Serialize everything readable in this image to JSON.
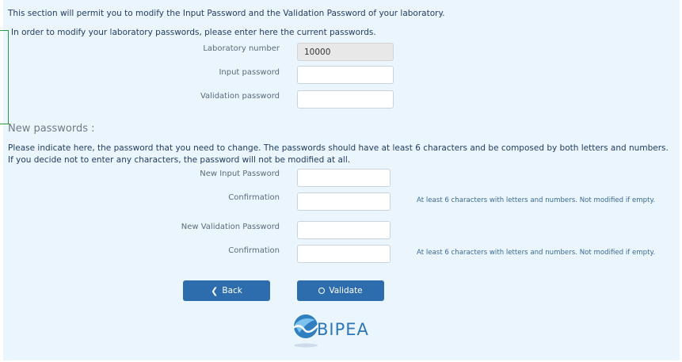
{
  "intro": "This section will permit you to modify the Input Password and the Validation Password of your laboratory.",
  "current": {
    "instruction": "In order to modify your laboratory passwords, please enter here the current passwords.",
    "lab_number_label": "Laboratory number",
    "lab_number_value": "10000",
    "input_password_label": "Input password",
    "validation_password_label": "Validation password"
  },
  "new": {
    "heading": "New passwords :",
    "instruction": "Please indicate here, the password that you need to change. The passwords should have at least 6 characters and be composed by both letters and numbers. If you decide not to enter any characters, the password will not be modified at all.",
    "new_input_label": "New Input Password",
    "confirmation_label": "Confirmation",
    "new_validation_label": "New Validation Password",
    "hint": "At least 6 characters with letters and numbers. Not modified if empty."
  },
  "buttons": {
    "back": "Back",
    "validate": "Validate"
  },
  "logo": {
    "text": "BIPEA"
  },
  "colors": {
    "panel": "#eaf5fd",
    "button": "#2e6dad",
    "bracket": "#2e9b3b",
    "text": "#1f3a5f"
  },
  "icons": {
    "back": "chevron-left-icon",
    "validate": "circle-icon"
  }
}
